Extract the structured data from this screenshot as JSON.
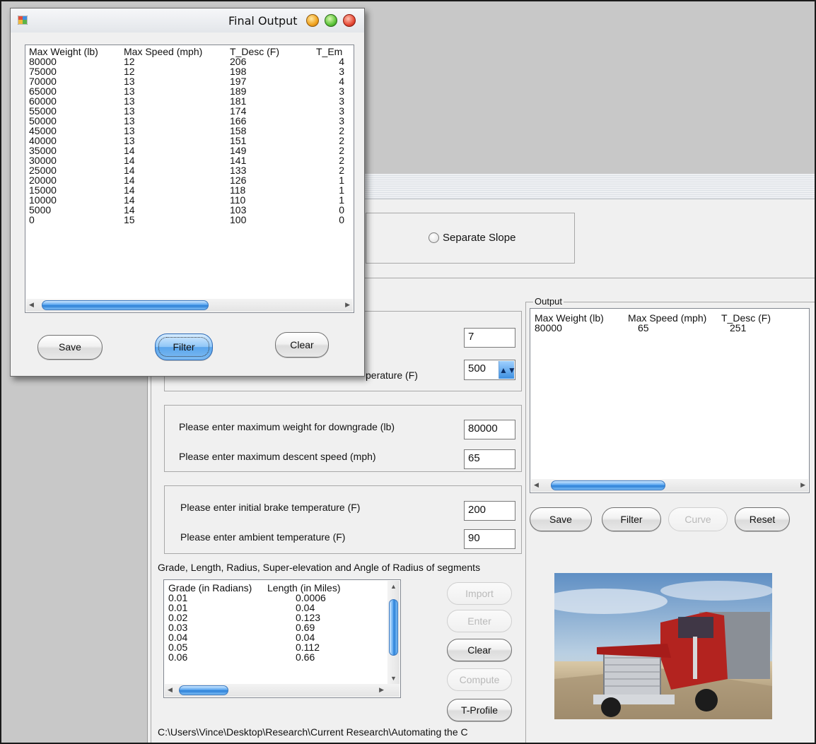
{
  "popup": {
    "title": "Final Output",
    "list": {
      "headers": [
        "Max Weight (lb)",
        "Max Speed (mph)",
        "T_Desc (F)",
        "T_Em"
      ],
      "rows": [
        [
          "80000",
          "12",
          "206",
          "4"
        ],
        [
          "75000",
          "12",
          "198",
          "3"
        ],
        [
          "70000",
          "13",
          "197",
          "4"
        ],
        [
          "65000",
          "13",
          "189",
          "3"
        ],
        [
          "60000",
          "13",
          "181",
          "3"
        ],
        [
          "55000",
          "13",
          "174",
          "3"
        ],
        [
          "50000",
          "13",
          "166",
          "3"
        ],
        [
          "45000",
          "13",
          "158",
          "2"
        ],
        [
          "40000",
          "13",
          "151",
          "2"
        ],
        [
          "35000",
          "14",
          "149",
          "2"
        ],
        [
          "30000",
          "14",
          "141",
          "2"
        ],
        [
          "25000",
          "14",
          "133",
          "2"
        ],
        [
          "20000",
          "14",
          "126",
          "1"
        ],
        [
          "15000",
          "14",
          "118",
          "1"
        ],
        [
          "10000",
          "14",
          "110",
          "1"
        ],
        [
          "5000",
          "14",
          "103",
          "0"
        ],
        [
          "0",
          "15",
          "100",
          "0"
        ]
      ]
    },
    "buttons": {
      "save": "Save",
      "filter": "Filter",
      "clear": "Clear"
    }
  },
  "main": {
    "separate_slope": "Separate Slope",
    "group1": {
      "value1": "7",
      "label2": "perature (F)",
      "value2": "500"
    },
    "group2": {
      "label1": "Please enter maximum weight for downgrade (lb)",
      "value1": "80000",
      "label2": "Please enter maximum descent speed (mph)",
      "value2": "65"
    },
    "group3": {
      "label1": "Please enter initial brake temperature (F)",
      "value1": "200",
      "label2": "Please enter ambient temperature (F)",
      "value2": "90"
    },
    "segments_label": "Grade, Length, Radius, Super-elevation and Angle of Radius of segments",
    "segments": {
      "headers": [
        "Grade (in Radians)",
        "Length (in Miles)"
      ],
      "rows": [
        [
          "0.01",
          "0.0006"
        ],
        [
          "0.01",
          "0.04"
        ],
        [
          "0.02",
          "0.123"
        ],
        [
          "0.03",
          "0.69"
        ],
        [
          "0.04",
          "0.04"
        ],
        [
          "0.05",
          "0.112"
        ],
        [
          "0.06",
          "0.66"
        ]
      ]
    },
    "segment_buttons": {
      "import": "Import",
      "enter": "Enter",
      "clear": "Clear",
      "compute": "Compute",
      "tprofile": "T-Profile"
    },
    "path": "C:\\Users\\Vince\\Desktop\\Research\\Current Research\\Automating the C",
    "output": {
      "title": "Output",
      "headers": [
        "Max Weight (lb)",
        "Max Speed (mph)",
        "T_Desc (F)"
      ],
      "row": [
        "80000",
        "65",
        "251"
      ]
    },
    "output_buttons": {
      "save": "Save",
      "filter": "Filter",
      "curve": "Curve",
      "reset": "Reset"
    }
  },
  "colors": {
    "accent": "#3d8fe0",
    "window_bg": "#f0f0f0",
    "desktop_bg": "#c8c8c8"
  }
}
